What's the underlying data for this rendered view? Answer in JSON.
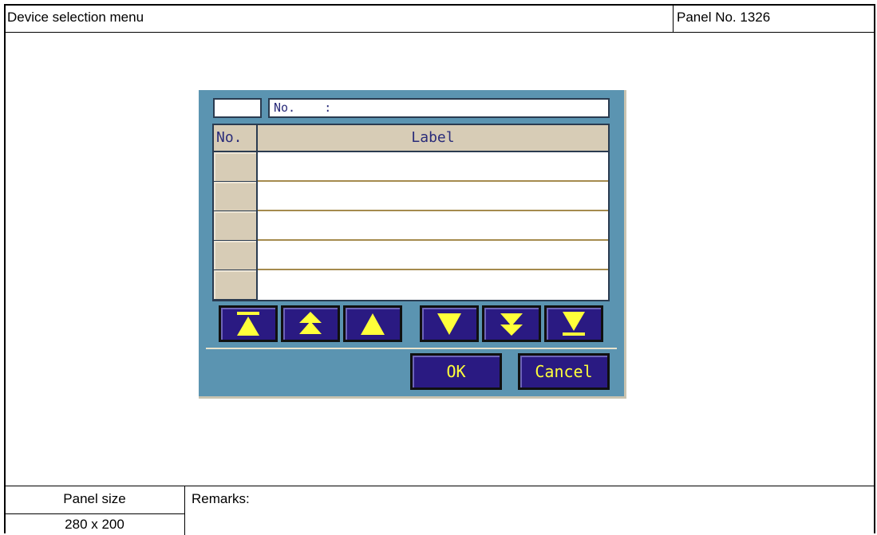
{
  "header": {
    "title": "Device selection menu",
    "panel_no": "Panel No. 1326"
  },
  "footer": {
    "panel_size_label": "Panel size",
    "panel_size_value": "280 x 200",
    "remarks_label": "Remarks:"
  },
  "panel": {
    "no_field": "No.    :",
    "table": {
      "col_no": "No.",
      "col_label": "Label",
      "rows": [
        "",
        "",
        "",
        "",
        ""
      ]
    },
    "nav_buttons": [
      "scroll-to-top",
      "page-up",
      "line-up",
      "line-down",
      "page-down",
      "scroll-to-bottom"
    ],
    "ok_label": "OK",
    "cancel_label": "Cancel",
    "colors": {
      "panel_bg": "#5b94b1",
      "button_bg": "#2a1a82",
      "arrow": "#ffff3a",
      "header_bg": "#d7ccb6"
    }
  }
}
